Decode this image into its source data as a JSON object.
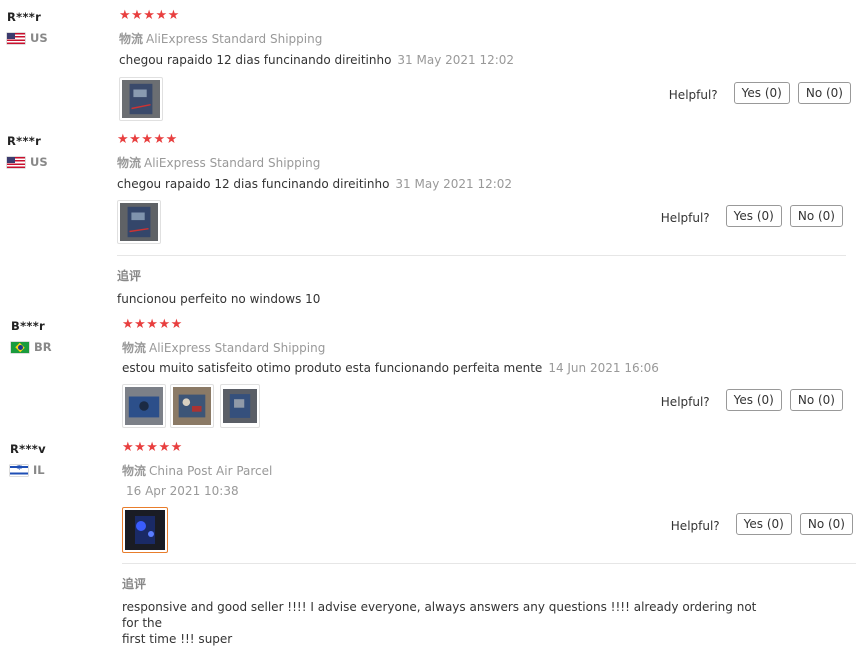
{
  "common": {
    "helpful_label": "Helpful?",
    "shipping_label": "物流",
    "followup_label": "追评"
  },
  "reviews": [
    {
      "user": "R***r",
      "country": "US",
      "flag": "us",
      "stars": "★★★★★",
      "shipping": "AliExpress Standard Shipping",
      "text": "chegou rapaido 12 dias funcinando direitinho",
      "date": "31 May 2021 12:02",
      "yes": "Yes (0)",
      "no": "No (0)"
    },
    {
      "user": "R***r",
      "country": "US",
      "flag": "us",
      "stars": "★★★★★",
      "shipping": "AliExpress Standard Shipping",
      "text": "chegou rapaido 12 dias funcinando direitinho",
      "date": "31 May 2021 12:02",
      "yes": "Yes (0)",
      "no": "No (0)",
      "followup": "funcionou perfeito no windows 10"
    },
    {
      "user": "B***r",
      "country": "BR",
      "flag": "br",
      "stars": "★★★★★",
      "shipping": "AliExpress Standard Shipping",
      "text": "estou muito satisfeito otimo produto esta funcionando perfeita mente",
      "date": "14 Jun 2021 16:06",
      "yes": "Yes (0)",
      "no": "No (0)"
    },
    {
      "user": "R***v",
      "country": "IL",
      "flag": "il",
      "stars": "★★★★★",
      "shipping": "China Post Air Parcel",
      "text": "",
      "date": "16 Apr 2021 10:38",
      "yes": "Yes (0)",
      "no": "No (0)",
      "followup_1": "responsive and good seller !!!! I advise everyone, always answers any questions !!!! already ordering not for the",
      "followup_2": "first time !!! super"
    }
  ]
}
